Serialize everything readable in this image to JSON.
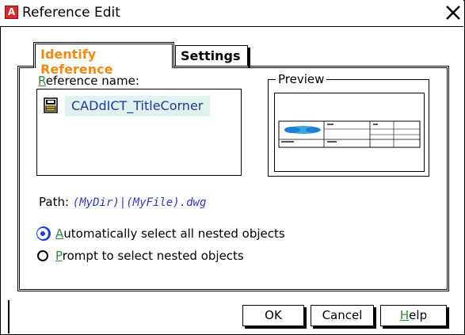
{
  "window": {
    "title": "Reference Edit",
    "app_icon_letter": "A"
  },
  "tabs": [
    {
      "label": "Identify Reference",
      "active": true
    },
    {
      "label": "Settings",
      "active": false
    }
  ],
  "reference": {
    "label_mnemonic": "R",
    "label_rest": "eference name:",
    "items": [
      {
        "name": "CADdICT_TitleCorner",
        "selected": true
      }
    ]
  },
  "preview": {
    "label": "Preview"
  },
  "path": {
    "label": "Path:",
    "value": "(MyDir)|(MyFile).dwg"
  },
  "options": [
    {
      "mnemonic": "A",
      "rest": "utomatically select all nested objects",
      "checked": true
    },
    {
      "mnemonic": "P",
      "rest": "rompt to select nested objects",
      "checked": false
    }
  ],
  "buttons": {
    "ok": "OK",
    "cancel": "Cancel",
    "help_mnemonic": "H",
    "help_rest": "elp"
  },
  "colors": {
    "active_tab_text": "#f08a10",
    "accent_blue": "#1a3fd6",
    "mnemonic_green": "#2f8a3b",
    "selection_bg": "#dff2ef",
    "path_value": "#2b3ac2"
  }
}
